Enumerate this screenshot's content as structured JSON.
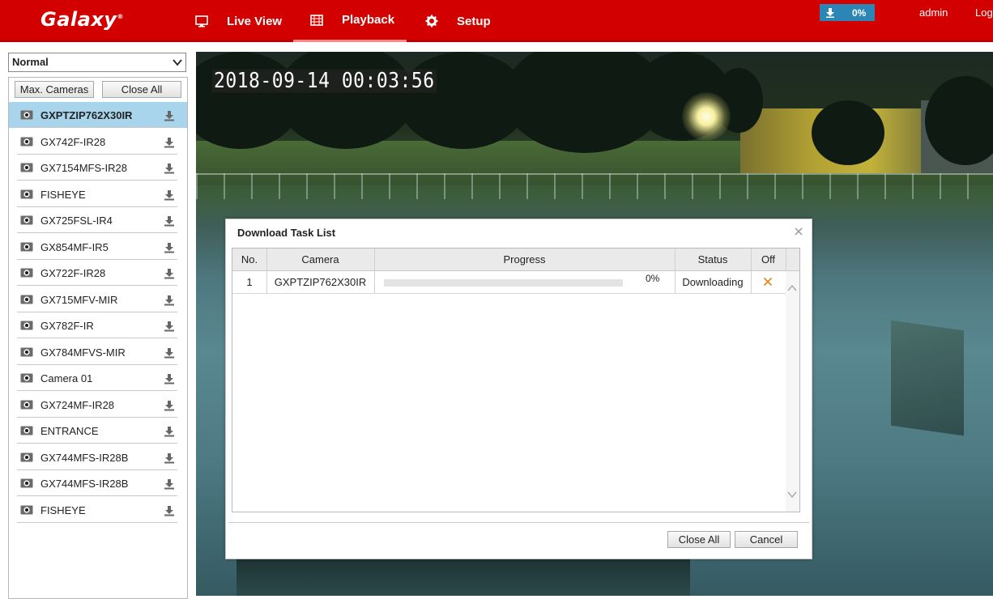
{
  "header": {
    "logo": "Galaxy",
    "nav": [
      {
        "label": "Live View",
        "icon": "monitor-icon"
      },
      {
        "label": "Playback",
        "icon": "film-icon",
        "active": true
      },
      {
        "label": "Setup",
        "icon": "gear-icon"
      }
    ],
    "download_progress": "0%",
    "user": "admin",
    "logout": "Log"
  },
  "left": {
    "mode": "Normal",
    "max_cameras_label": "Max. Cameras",
    "close_all_label": "Close All",
    "cameras": [
      "GXPTZIP762X30IR",
      "GX742F-IR28",
      "GX7154MFS-IR28",
      "FISHEYE",
      "GX725FSL-IR4",
      "GX854MF-IR5",
      "GX722F-IR28",
      "GX715MFV-MIR",
      "GX782F-IR",
      "GX784MFVS-MIR",
      "Camera 01",
      "GX724MF-IR28",
      "ENTRANCE",
      "GX744MFS-IR28B",
      "GX744MFS-IR28B",
      "FISHEYE"
    ],
    "selected_index": 0
  },
  "video": {
    "timestamp": "2018-09-14 00:03:56"
  },
  "dialog": {
    "title": "Download Task List",
    "columns": [
      "No.",
      "Camera",
      "Progress",
      "Status",
      "Off"
    ],
    "rows": [
      {
        "no": "1",
        "camera": "GXPTZIP762X30IR",
        "progress": 0,
        "progress_text": "0%",
        "status": "Downloading"
      }
    ],
    "close_all_label": "Close All",
    "cancel_label": "Cancel"
  },
  "colors": {
    "header_bg": "#d30000",
    "selected_row": "#a9d5ec",
    "badge": "#2b86b6",
    "off_icon": "#e08a1e"
  }
}
